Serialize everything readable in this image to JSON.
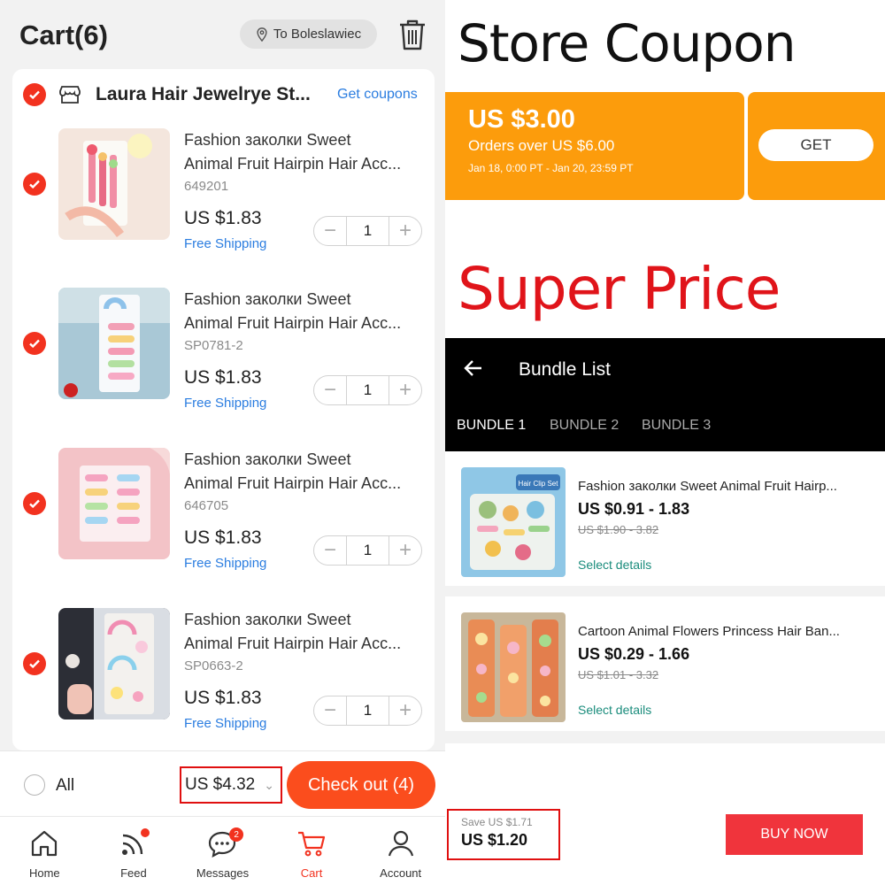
{
  "cart": {
    "title": "Cart(6)",
    "location": "To Boleslawiec",
    "store": {
      "name": "Laura Hair Jewelrye St...",
      "get_coupons": "Get coupons"
    },
    "items": [
      {
        "title_line1": "Fashion заколки Sweet",
        "title_line2": "Animal Fruit Hairpin Hair Acc...",
        "sku": "649201",
        "price": "US $1.83",
        "shipping": "Free Shipping",
        "qty": "1"
      },
      {
        "title_line1": "Fashion заколки Sweet",
        "title_line2": "Animal Fruit Hairpin Hair Acc...",
        "sku": "SP0781-2",
        "price": "US $1.83",
        "shipping": "Free Shipping",
        "qty": "1"
      },
      {
        "title_line1": "Fashion заколки Sweet",
        "title_line2": "Animal Fruit Hairpin Hair Acc...",
        "sku": "646705",
        "price": "US $1.83",
        "shipping": "Free Shipping",
        "qty": "1"
      },
      {
        "title_line1": "Fashion заколки Sweet",
        "title_line2": "Animal Fruit Hairpin Hair Acc...",
        "sku": "SP0663-2",
        "price": "US $1.83",
        "shipping": "Free Shipping",
        "qty": "1"
      }
    ],
    "select_all": "All",
    "total": "US $4.32",
    "checkout": "Check out (4)"
  },
  "nav": {
    "items": [
      {
        "label": "Home",
        "icon": "home-icon"
      },
      {
        "label": "Feed",
        "icon": "feed-icon"
      },
      {
        "label": "Messages",
        "icon": "messages-icon",
        "badge": "2"
      },
      {
        "label": "Cart",
        "icon": "cart-icon"
      },
      {
        "label": "Account",
        "icon": "account-icon"
      }
    ]
  },
  "coupon_section": {
    "heading": "Store Coupon",
    "amount": "US $3.00",
    "condition": "Orders over US $6.00",
    "dates": "Jan 18, 0:00 PT - Jan 20, 23:59 PT",
    "get": "GET"
  },
  "super_price": {
    "heading": "Super Price"
  },
  "bundle": {
    "title": "Bundle List",
    "tabs": [
      "BUNDLE 1",
      "BUNDLE 2",
      "BUNDLE 3"
    ],
    "products": [
      {
        "name": "Fashion заколки Sweet Animal Fruit Hairp...",
        "price": "US $0.91 - 1.83",
        "old_price": "US $1.90 - 3.82",
        "select": "Select details",
        "thumb_label": "Hair Clip Set"
      },
      {
        "name": "Cartoon Animal Flowers Princess Hair Ban...",
        "price": "US $0.29 - 1.66",
        "old_price": "US $1.01 - 3.32",
        "select": "Select details"
      }
    ],
    "save": "Save US $1.71",
    "total": "US $1.20",
    "buy_now": "BUY NOW"
  },
  "colors": {
    "accent_red": "#f2321f",
    "checkout_orange": "#fb4d1d",
    "coupon_orange": "#fc9c0c",
    "link_blue": "#2b7de0",
    "super_price_red": "#e0141a"
  }
}
